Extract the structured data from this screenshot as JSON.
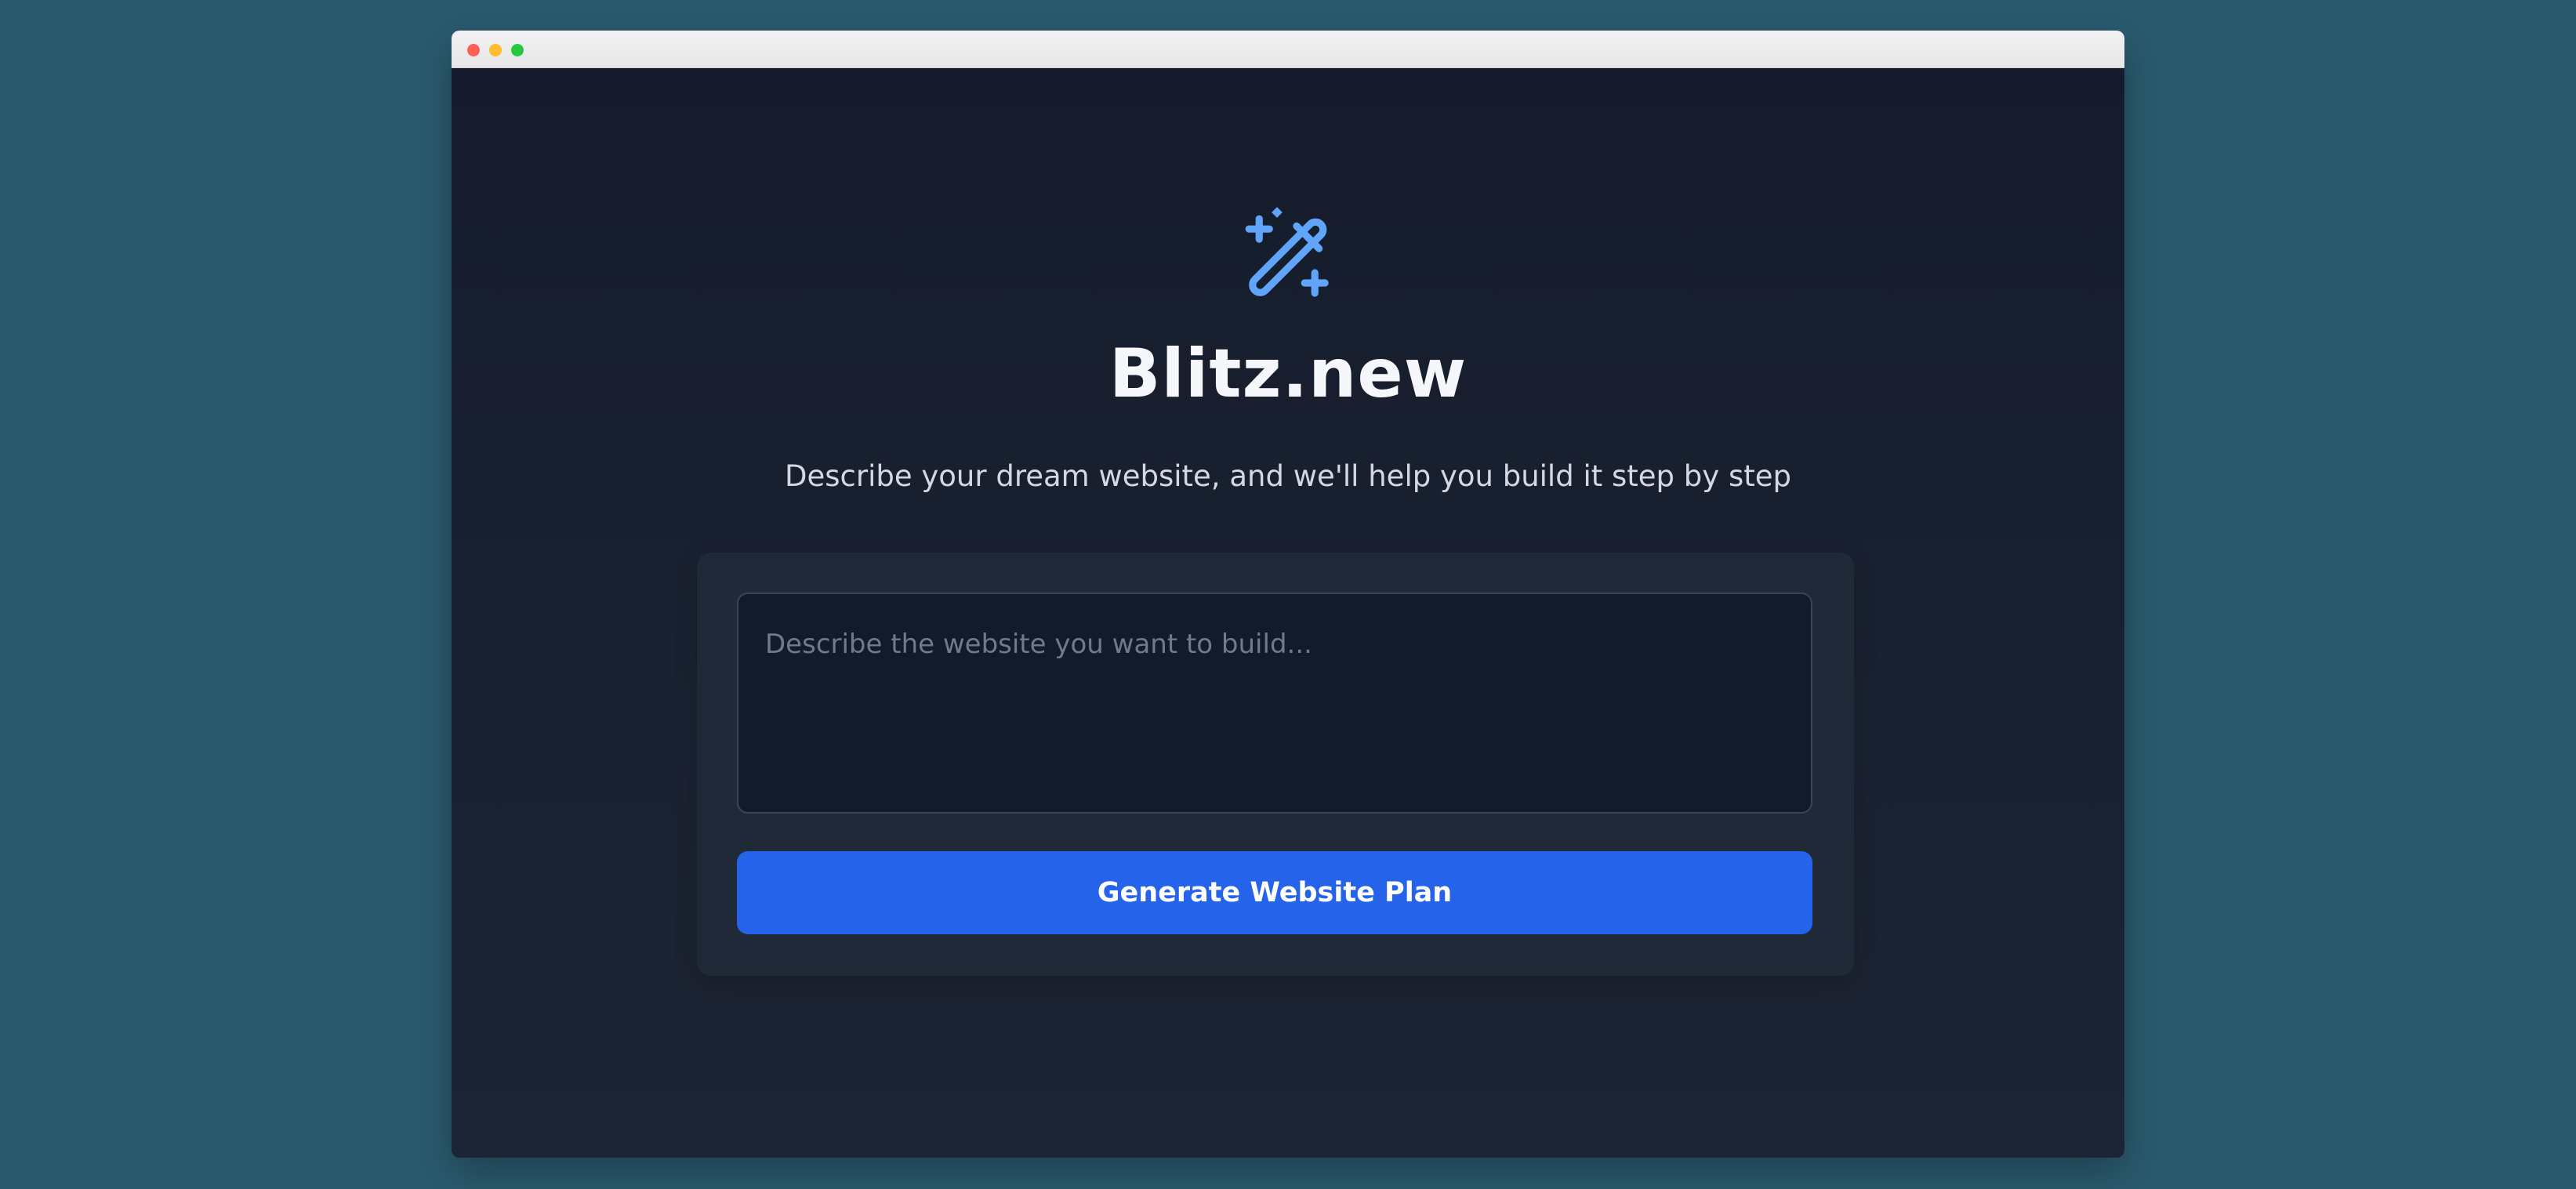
{
  "window": {
    "controls": [
      {
        "name": "close",
        "color": "#ff5f57"
      },
      {
        "name": "minimize",
        "color": "#febc2e"
      },
      {
        "name": "maximize",
        "color": "#28c840"
      }
    ]
  },
  "header": {
    "icon": "magic-wand-icon",
    "title": "Blitz.new",
    "subtitle": "Describe your dream website, and we'll help you build it step by step"
  },
  "form": {
    "prompt_placeholder": "Describe the website you want to build...",
    "prompt_value": "",
    "submit_label": "Generate Website Plan"
  },
  "colors": {
    "background": "#2a5a6e",
    "window_bg": "#182033",
    "card_bg": "#202937",
    "accent": "#2563eb",
    "icon": "#60a5fa",
    "title": "#f5f7fb"
  }
}
